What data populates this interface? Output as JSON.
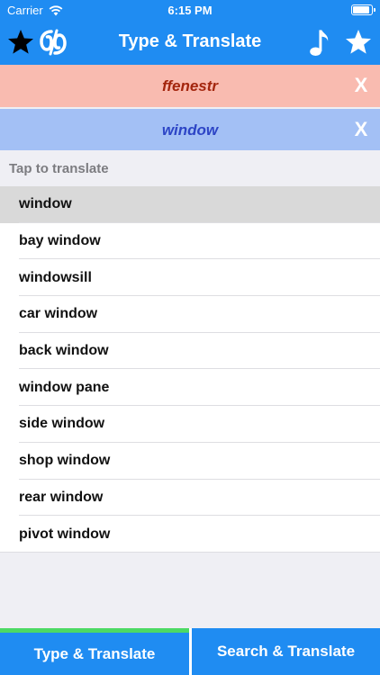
{
  "status_bar": {
    "carrier": "Carrier",
    "time": "6:15 PM",
    "battery_level": 0.95
  },
  "nav": {
    "title": "Type & Translate",
    "icons": [
      "star-icon",
      "app-logo-icon",
      "music-note-icon",
      "star-icon"
    ]
  },
  "source_box": {
    "text": "ffenestr",
    "clear_label": "X",
    "color": "#f9bbb0"
  },
  "target_box": {
    "text": "window",
    "clear_label": "X",
    "color": "#a3c0f5"
  },
  "suggestions": {
    "header": "Tap to translate",
    "items": [
      {
        "label": "window"
      },
      {
        "label": "bay window"
      },
      {
        "label": "windowsill"
      },
      {
        "label": "car window"
      },
      {
        "label": "back window"
      },
      {
        "label": "window pane"
      },
      {
        "label": "side window"
      },
      {
        "label": "shop window"
      },
      {
        "label": "rear window"
      },
      {
        "label": "pivot window"
      }
    ],
    "selected_index": 0
  },
  "tabbar": {
    "tabs": [
      {
        "label": "Type & Translate",
        "active": true
      },
      {
        "label": "Search & Translate",
        "active": false
      }
    ],
    "accent": "#4cd964"
  },
  "colors": {
    "brand": "#1f8cf2"
  }
}
